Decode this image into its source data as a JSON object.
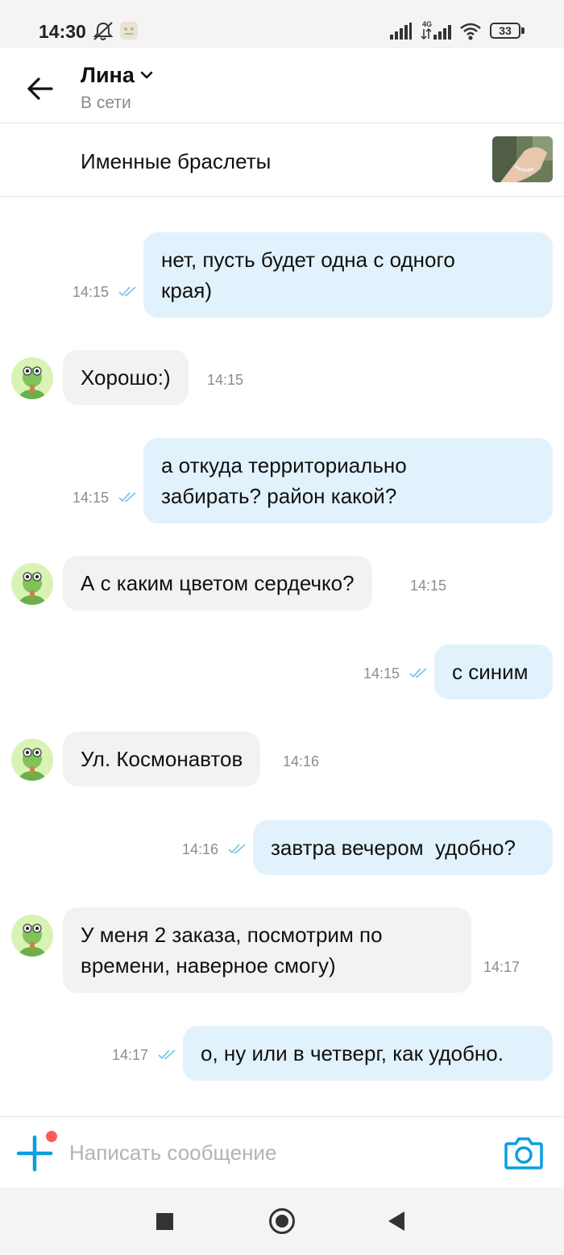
{
  "status_bar": {
    "time": "14:30",
    "network": "4G",
    "battery": "33",
    "icons": [
      "mute-notifications-icon",
      "app-notification-icon",
      "signal-icon",
      "mobile-data-icon",
      "wifi-icon",
      "battery-icon"
    ]
  },
  "header": {
    "back_icon": "arrow-left-icon",
    "contact_name": "Лина",
    "name_icon": "chevron-down-icon",
    "contact_status": "В сети"
  },
  "listing": {
    "title": "Именные браслеты",
    "thumbnail_icon": "bracelet-photo"
  },
  "messages": [
    {
      "direction": "out",
      "text_lines": [
        "нет, пусть будет одна с одного",
        "края)"
      ],
      "time": "14:15",
      "read": true
    },
    {
      "direction": "in",
      "text_lines": [
        "Хорошо:)"
      ],
      "time": "14:15"
    },
    {
      "direction": "out",
      "text_lines": [
        "а откуда территориально",
        "забирать? район какой?"
      ],
      "time": "14:15",
      "read": true
    },
    {
      "direction": "in",
      "text_lines": [
        "А с каким цветом сердечко?"
      ],
      "time": "14:15"
    },
    {
      "direction": "out",
      "text_lines": [
        "с синим"
      ],
      "time": "14:15",
      "read": true
    },
    {
      "direction": "in",
      "text_lines": [
        "Ул. Космонавтов"
      ],
      "time": "14:16"
    },
    {
      "direction": "out",
      "text_lines": [
        "завтра вечером  удобно?"
      ],
      "time": "14:16",
      "read": true
    },
    {
      "direction": "in",
      "text_lines": [
        "У меня 2 заказа, посмотрим по",
        "времени, наверное смогу)"
      ],
      "time": "14:17"
    },
    {
      "direction": "out",
      "text_lines": [
        "о, ну или в четверг, как удобно."
      ],
      "time": "14:17",
      "read": true
    }
  ],
  "compose": {
    "add_icon": "plus-icon",
    "placeholder": "Написать сообщение",
    "value": "",
    "camera_icon": "camera-icon"
  },
  "nav_bar": {
    "icons": [
      "recent-apps-icon",
      "home-icon",
      "back-icon"
    ]
  },
  "colors": {
    "outgoing_bubble": "#e2f2fc",
    "incoming_bubble": "#f2f2f2",
    "accent": "#0a9ee0",
    "read_ticks": "#7cc6ef",
    "notification_dot": "#ff5a5a"
  }
}
